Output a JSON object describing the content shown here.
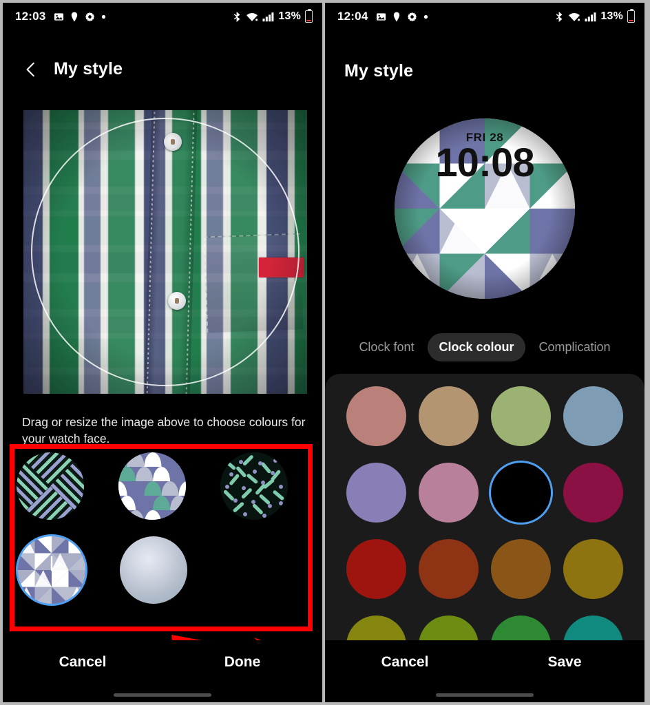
{
  "left_phone": {
    "status_bar": {
      "time": "12:03",
      "battery_percent": "13%",
      "icons": [
        "image-icon",
        "location-pin-icon",
        "gear-icon",
        "dot-icon",
        "bluetooth-icon",
        "wifi-icon",
        "signal-icon",
        "battery-icon"
      ]
    },
    "header": {
      "back_label": "back-chevron",
      "title": "My style"
    },
    "photo": {
      "alt": "plaid shirt photo with circular crop guide",
      "crop_guide": "circle"
    },
    "hint_text": "Drag or resize the image above to choose colours for your watch face.",
    "thumbnails": [
      {
        "name": "chevron-pattern",
        "selected": false
      },
      {
        "name": "scales-pattern",
        "selected": false
      },
      {
        "name": "dashes-pattern",
        "selected": false
      },
      {
        "name": "triangles-watch-face",
        "selected": true
      },
      {
        "name": "gradient-blob",
        "selected": false
      }
    ],
    "buttons": {
      "cancel": "Cancel",
      "primary": "Done"
    },
    "annotation": {
      "box_colour": "#fe0000",
      "arrow_colour": "#fe0000",
      "arrow_target": "Done"
    }
  },
  "right_phone": {
    "status_bar": {
      "time": "12:04",
      "battery_percent": "13%",
      "icons": [
        "image-icon",
        "location-pin-icon",
        "gear-icon",
        "dot-icon",
        "bluetooth-icon",
        "wifi-icon",
        "signal-icon",
        "battery-icon"
      ]
    },
    "header": {
      "title": "My style"
    },
    "watch_preview": {
      "date": "FRI 28",
      "time": "10:08"
    },
    "tabs": [
      {
        "label": "Clock font",
        "active": false
      },
      {
        "label": "Clock colour",
        "active": true
      },
      {
        "label": "Complication",
        "active": false
      }
    ],
    "colours": [
      {
        "hex": "#b9817a",
        "selected": false
      },
      {
        "hex": "#b39571",
        "selected": false
      },
      {
        "hex": "#9cb272",
        "selected": false
      },
      {
        "hex": "#7e9cb4",
        "selected": false
      },
      {
        "hex": "#8a7eb6",
        "selected": false
      },
      {
        "hex": "#b9809c",
        "selected": false
      },
      {
        "hex": "#000000",
        "selected": true
      },
      {
        "hex": "#8b1044",
        "selected": false
      },
      {
        "hex": "#9e1510",
        "selected": false
      },
      {
        "hex": "#8f3315",
        "selected": false
      },
      {
        "hex": "#8a5618",
        "selected": false
      },
      {
        "hex": "#8e7410",
        "selected": false
      },
      {
        "hex": "#85860f",
        "selected": false
      },
      {
        "hex": "#6d8d12",
        "selected": false
      },
      {
        "hex": "#2d8a33",
        "selected": false
      },
      {
        "hex": "#10897f",
        "selected": false
      }
    ],
    "buttons": {
      "cancel": "Cancel",
      "primary": "Save"
    },
    "annotation": {
      "arrow_colour": "#fe0000",
      "arrow_target": "Save"
    }
  }
}
